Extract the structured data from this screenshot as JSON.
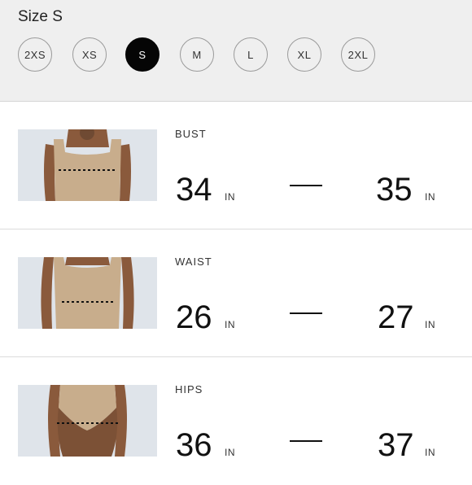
{
  "size_selector": {
    "title": "Size S",
    "options": [
      "2XS",
      "XS",
      "S",
      "M",
      "L",
      "XL",
      "2XL"
    ],
    "selected": "S"
  },
  "measurements": [
    {
      "label": "BUST",
      "min": "34",
      "max": "35",
      "unit": "IN",
      "image": "bust-measurement-photo"
    },
    {
      "label": "WAIST",
      "min": "26",
      "max": "27",
      "unit": "IN",
      "image": "waist-measurement-photo"
    },
    {
      "label": "HIPS",
      "min": "36",
      "max": "37",
      "unit": "IN",
      "image": "hips-measurement-photo"
    }
  ],
  "colors": {
    "header_bg": "#efefef",
    "selected_bg": "#050505",
    "garment": "#c8ad8c",
    "skin": "#8a5a3c"
  }
}
